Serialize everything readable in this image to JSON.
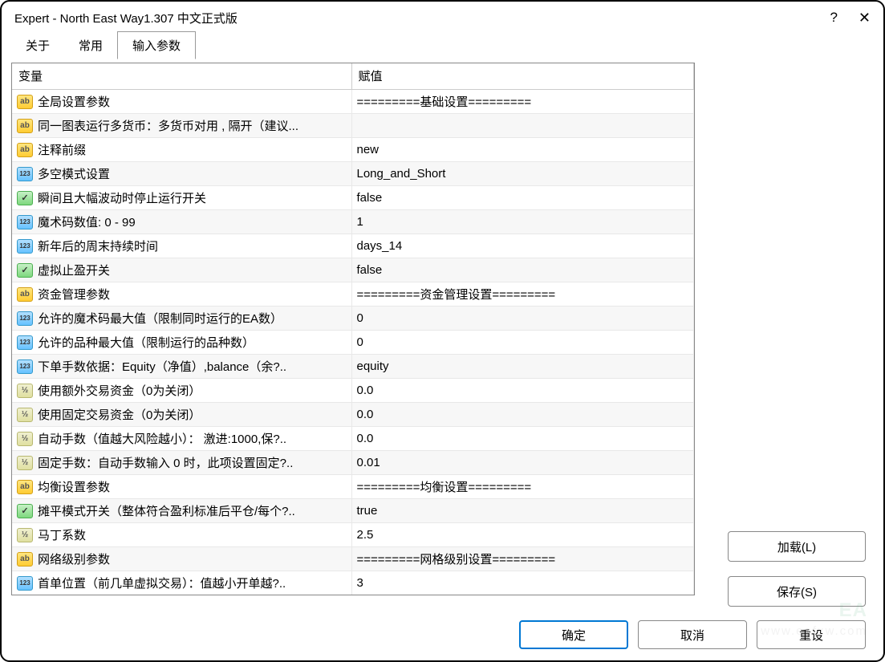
{
  "window": {
    "title": "Expert - North East Way1.307  中文正式版"
  },
  "tabs": {
    "about": "关于",
    "common": "常用",
    "inputs": "输入参数"
  },
  "headers": {
    "variable": "变量",
    "value": "赋值"
  },
  "rows": [
    {
      "icon": "ab",
      "var": "全局设置参数",
      "val": "=========基础设置========="
    },
    {
      "icon": "ab",
      "var": "同一图表运行多货币：多货币对用 , 隔开（建议...",
      "val": ""
    },
    {
      "icon": "ab",
      "var": "注释前缀",
      "val": "new"
    },
    {
      "icon": "123",
      "var": "多空模式设置",
      "val": "Long_and_Short"
    },
    {
      "icon": "bool",
      "var": "瞬间且大幅波动时停止运行开关",
      "val": "false"
    },
    {
      "icon": "123",
      "var": "魔术码数值: 0 - 99",
      "val": "1"
    },
    {
      "icon": "123",
      "var": "新年后的周末持续时间",
      "val": "days_14"
    },
    {
      "icon": "bool",
      "var": "虚拟止盈开关",
      "val": "false"
    },
    {
      "icon": "ab",
      "var": "资金管理参数",
      "val": "=========资金管理设置========="
    },
    {
      "icon": "123",
      "var": "允许的魔术码最大值（限制同时运行的EA数）",
      "val": "0"
    },
    {
      "icon": "123",
      "var": "允许的品种最大值（限制运行的品种数）",
      "val": "0"
    },
    {
      "icon": "123",
      "var": "下单手数依据：Equity（净值）,balance（余?..",
      "val": "equity"
    },
    {
      "icon": "v2",
      "var": "使用额外交易资金（0为关闭）",
      "val": "0.0"
    },
    {
      "icon": "v2",
      "var": "使用固定交易资金（0为关闭）",
      "val": "0.0"
    },
    {
      "icon": "v2",
      "var": "自动手数（值越大风险越小）： 激进:1000,保?..",
      "val": "0.0"
    },
    {
      "icon": "v2",
      "var": "固定手数：自动手数输入 0 时，此项设置固定?..",
      "val": "0.01"
    },
    {
      "icon": "ab",
      "var": "均衡设置参数",
      "val": "=========均衡设置========="
    },
    {
      "icon": "bool",
      "var": "摊平模式开关（整体符合盈利标准后平仓/每个?..",
      "val": "true"
    },
    {
      "icon": "v2",
      "var": "马丁系数",
      "val": "2.5"
    },
    {
      "icon": "ab",
      "var": "网络级别参数",
      "val": "=========网格级别设置========="
    },
    {
      "icon": "123",
      "var": "首单位置（前几单虚拟交易）：值越小开单越?..",
      "val": "3"
    }
  ],
  "buttons": {
    "load": "加载(L)",
    "save": "保存(S)",
    "ok": "确定",
    "cancel": "取消",
    "reset": "重设"
  },
  "watermark": {
    "main": "EA",
    "sub": "www.eafxw.com"
  }
}
